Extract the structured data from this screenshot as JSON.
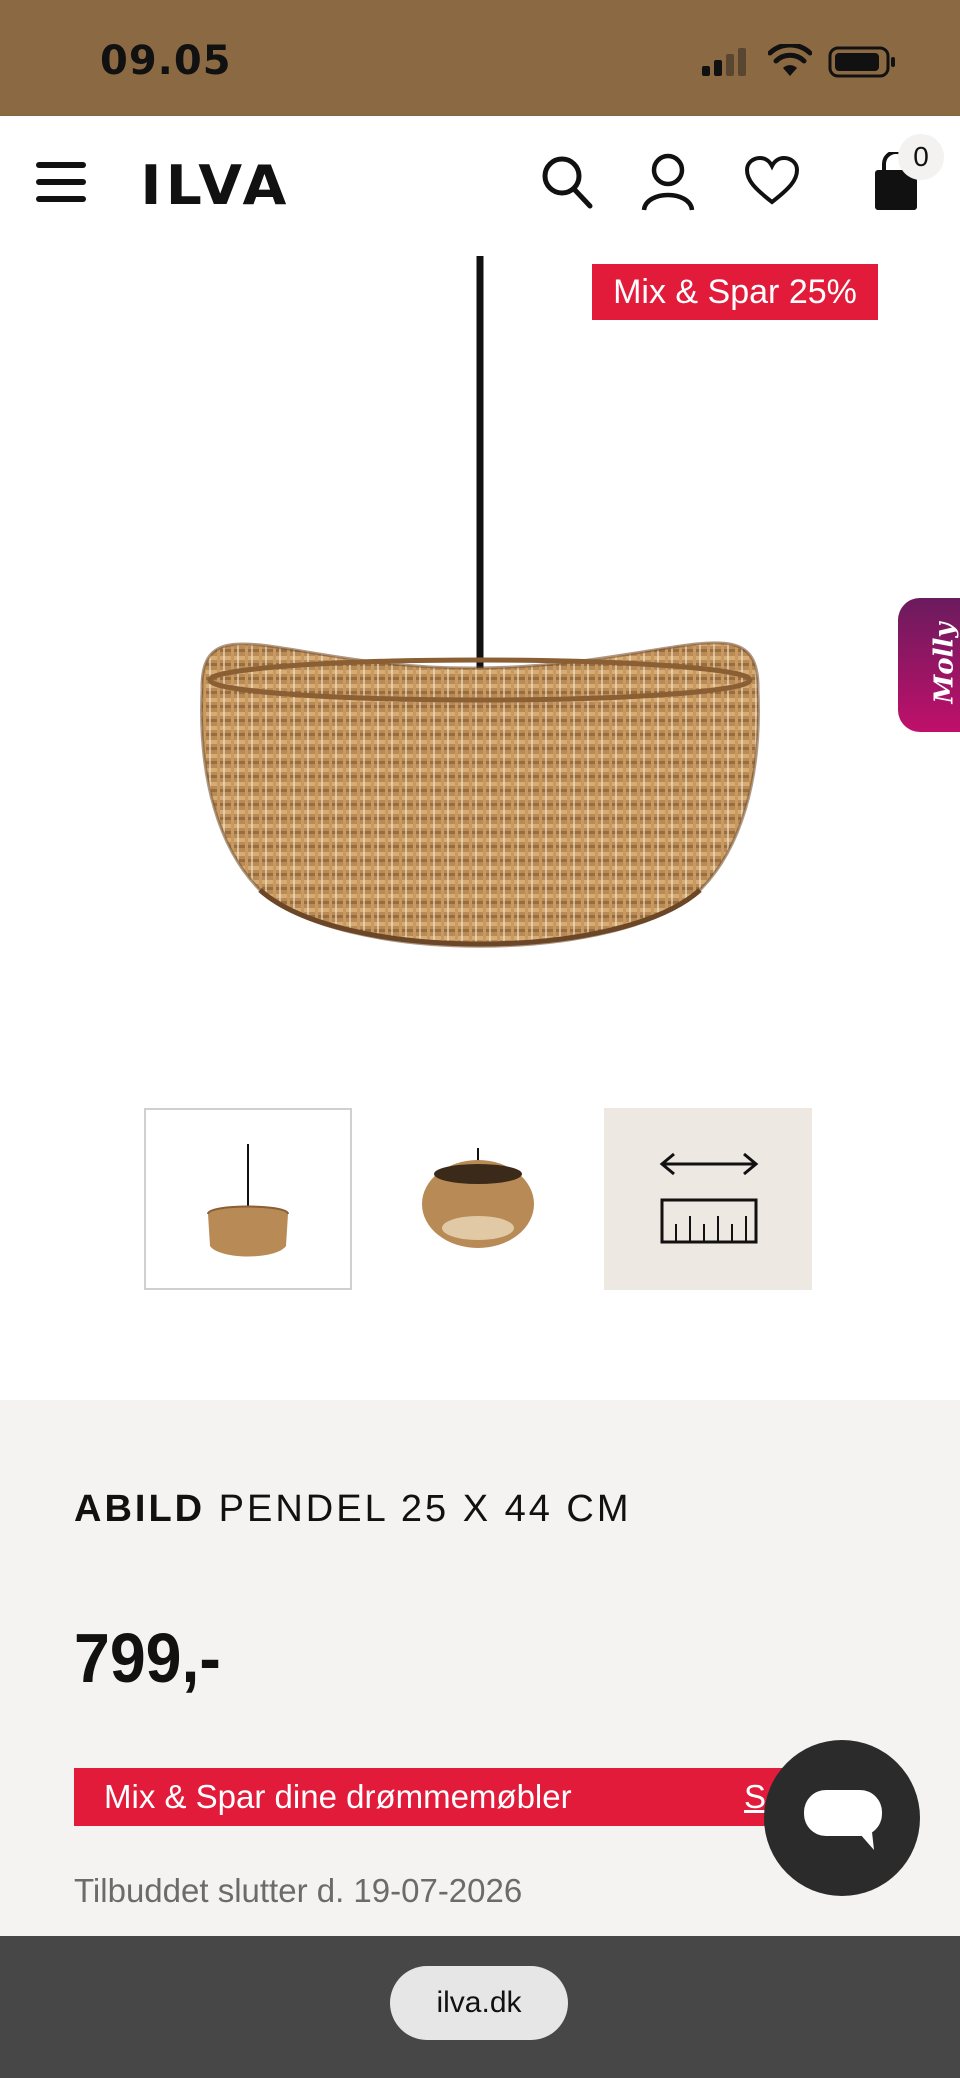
{
  "status_bar": {
    "time": "09.05"
  },
  "header": {
    "logo": "ILVA",
    "cart_count": "0"
  },
  "hero": {
    "badge": "Mix & Spar 25%",
    "side_tab": "Molly"
  },
  "product": {
    "brand": "ABILD",
    "name": "PENDEL 25 X 44 CM",
    "price": "799,-",
    "promo_text": "Mix & Spar dine drømmemøbler",
    "promo_link": "Se",
    "offer_ends": "Tilbuddet slutter d. 19-07-2026"
  },
  "browser": {
    "url": "ilva.dk"
  },
  "colors": {
    "status_bg": "#8b6a43",
    "accent_red": "#e31b3b",
    "info_bg": "#f4f3f1",
    "bottom_bar": "#474747"
  }
}
